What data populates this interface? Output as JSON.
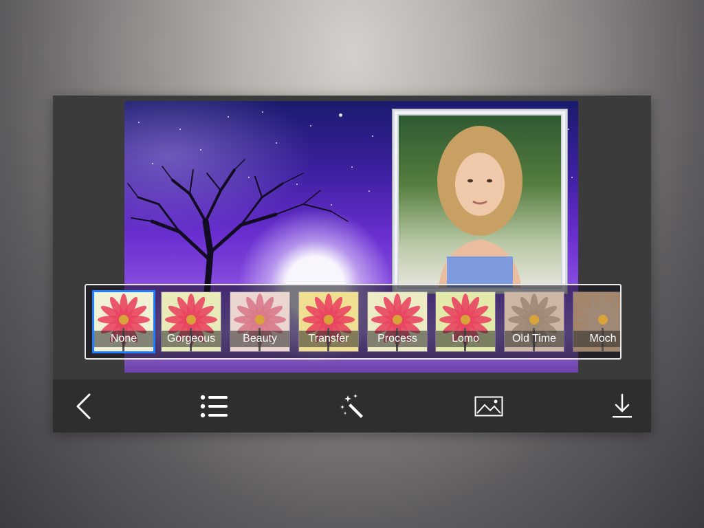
{
  "filters": [
    {
      "label": "None",
      "selected": true,
      "tint": "#f1f1d6"
    },
    {
      "label": "Gorgeous",
      "selected": false,
      "tint": "#e8ebb8"
    },
    {
      "label": "Beauty",
      "selected": false,
      "tint": "#ead6cf"
    },
    {
      "label": "Transfer",
      "selected": false,
      "tint": "#f1df91"
    },
    {
      "label": "Process",
      "selected": false,
      "tint": "#ecebc4"
    },
    {
      "label": "Lomo",
      "selected": false,
      "tint": "#e3eaa9"
    },
    {
      "label": "Old Time",
      "selected": false,
      "tint": "#cdb6a3"
    },
    {
      "label": "Moch",
      "selected": false,
      "tint": "#a2856a"
    }
  ],
  "toolbar": {
    "back": "back-chevron-icon",
    "list": "list-icon",
    "effects": "magic-wand-icon",
    "gallery": "image-icon",
    "download": "download-icon"
  },
  "colors": {
    "accent": "#1f7bff",
    "toolbar": "#2e2e2e",
    "panel": "#3b3b3b"
  }
}
